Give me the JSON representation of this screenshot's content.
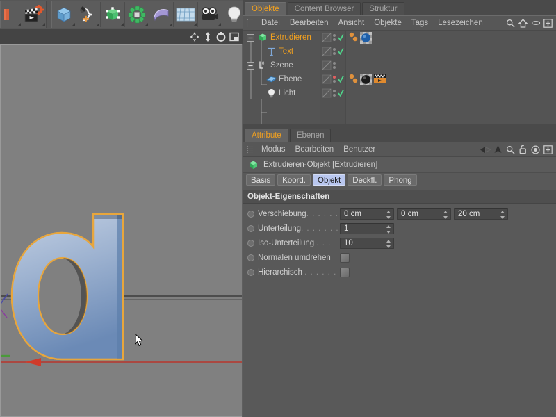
{
  "toolbar_left": {
    "groups": [
      {
        "name": "render-group",
        "icons": [
          {
            "name": "render-view-icon",
            "label": "Ansicht rendern"
          },
          {
            "name": "render-settings-icon",
            "label": "Rendervoreinstellungen"
          }
        ]
      },
      {
        "name": "primitives-group",
        "icons": [
          {
            "name": "cube-primitive-icon",
            "label": "Würfel"
          },
          {
            "name": "spline-pen-icon",
            "label": "Spline-Werkzeuge"
          },
          {
            "name": "nurbs-generator-icon",
            "label": "NURBS"
          },
          {
            "name": "array-modeling-icon",
            "label": "Modeling-Objekte"
          },
          {
            "name": "deformer-icon",
            "label": "Deformer"
          },
          {
            "name": "floor-environment-icon",
            "label": "Szene-Objekte"
          },
          {
            "name": "camera-icon",
            "label": "Kamera"
          },
          {
            "name": "light-icon",
            "label": "Licht"
          }
        ]
      }
    ]
  },
  "viewport": {
    "header_icons": [
      {
        "name": "move-view-icon",
        "label": "Ansicht verschieben"
      },
      {
        "name": "zoom-view-icon",
        "label": "Ansicht zoomen"
      },
      {
        "name": "rotate-view-icon",
        "label": "Ansicht drehen"
      },
      {
        "name": "toggle-layout-icon",
        "label": "Ansichten umschalten"
      }
    ],
    "object_label": "d",
    "background_color": "#808080",
    "object_fill_top": "#b7c6dd",
    "object_fill_bottom": "#6b8bb8",
    "selection_outline_color": "#e8a63c",
    "axis_x_color": "#c0392b",
    "axis_z_color": "#3a3a3a",
    "axis_y_color": "#4a9a3a"
  },
  "objects_panel": {
    "tabs": [
      {
        "label": "Objekte",
        "active": true
      },
      {
        "label": "Content Browser",
        "active": false
      },
      {
        "label": "Struktur",
        "active": false
      }
    ],
    "menu": [
      "Datei",
      "Bearbeiten",
      "Ansicht",
      "Objekte",
      "Tags",
      "Lesezeichen"
    ],
    "menu_icons": [
      {
        "name": "search-icon",
        "label": "Suchen"
      },
      {
        "name": "home-icon",
        "label": "Start"
      },
      {
        "name": "ellipse-icon",
        "label": "Ansicht"
      },
      {
        "name": "plus-box-icon",
        "label": "Hinzufügen"
      }
    ],
    "tree": [
      {
        "name": "Extrudieren",
        "icon": "extrude-object-icon",
        "selected": true,
        "depth": 0,
        "expander": "minus",
        "has_visibility": true,
        "visible_check": true,
        "dot_color": "#8a8a8a",
        "materials": [
          "blue-material-sphere"
        ],
        "extra_tags": []
      },
      {
        "name": "Text",
        "icon": "text-spline-icon",
        "selected": true,
        "depth": 1,
        "expander": "none",
        "has_visibility": true,
        "visible_check": true,
        "dot_color": "#8a8a8a",
        "materials": [],
        "extra_tags": []
      },
      {
        "name": "Szene",
        "icon": "null-scene-icon",
        "selected": false,
        "depth": 0,
        "expander": "minus",
        "has_visibility": true,
        "visible_check": false,
        "dot_color": "#8a8a8a",
        "materials": [],
        "extra_tags": []
      },
      {
        "name": "Ebene",
        "icon": "plane-floor-icon",
        "selected": false,
        "depth": 1,
        "expander": "none",
        "has_visibility": true,
        "visible_check": true,
        "dot_color": "#e06060",
        "materials": [
          "dark-material-sphere"
        ],
        "extra_tags": [
          "compositing-tag-icon"
        ]
      },
      {
        "name": "Licht",
        "icon": "light-object-icon",
        "selected": false,
        "depth": 1,
        "expander": "none",
        "has_visibility": true,
        "visible_check": true,
        "dot_color": "#8a8a8a",
        "materials": [],
        "extra_tags": []
      }
    ]
  },
  "attribute_panel": {
    "tabs": [
      {
        "label": "Attribute",
        "active": true
      },
      {
        "label": "Ebenen",
        "active": false
      }
    ],
    "menu": [
      "Modus",
      "Bearbeiten",
      "Benutzer"
    ],
    "menu_icons": [
      {
        "name": "back-arrow-icon",
        "label": "Zurück"
      },
      {
        "name": "forward-arrow-icon",
        "label": "Vorwärts"
      },
      {
        "name": "up-arrow-icon",
        "label": "Aufwärts"
      },
      {
        "name": "search-icon",
        "label": "Suchen"
      },
      {
        "name": "lock-icon",
        "label": "Sperren"
      },
      {
        "name": "target-icon",
        "label": "Fokus"
      },
      {
        "name": "plus-box-icon",
        "label": "Hinzufügen"
      }
    ],
    "object_title": "Extrudieren-Objekt [Extrudieren]",
    "object_icon": "extrude-object-icon",
    "property_tabs": [
      {
        "label": "Basis",
        "active": false
      },
      {
        "label": "Koord.",
        "active": false
      },
      {
        "label": "Objekt",
        "active": true
      },
      {
        "label": "Deckfl.",
        "active": false
      },
      {
        "label": "Phong",
        "active": false
      }
    ],
    "section_title": "Objekt-Eigenschaften",
    "properties": [
      {
        "name": "verschiebung",
        "label": "Verschiebung",
        "dots": ". . . . . .",
        "type": "vector3",
        "values": [
          "0 cm",
          "0 cm",
          "20 cm"
        ]
      },
      {
        "name": "unterteilung",
        "label": "Unterteilung",
        "dots": ". . . . . . .",
        "type": "number",
        "values": [
          "1"
        ]
      },
      {
        "name": "iso-unterteilung",
        "label": "Iso-Unterteilung",
        "dots": ". . .",
        "type": "number",
        "values": [
          "10"
        ]
      },
      {
        "name": "normalen-umdrehen",
        "label": "Normalen umdrehen",
        "dots": "",
        "type": "checkbox",
        "checked": false
      },
      {
        "name": "hierarchisch",
        "label": "Hierarchisch",
        "dots": ". . . . . . .",
        "type": "checkbox",
        "checked": false
      }
    ]
  },
  "theme": {
    "panel_bg": "#595959",
    "menubar_bg": "#575757",
    "tabstrip_bg": "#4a4a4a",
    "active_tab_text": "#f0a020",
    "active_prop_tab_bg": "#b9c7ef",
    "text": "#c8c8c8"
  }
}
